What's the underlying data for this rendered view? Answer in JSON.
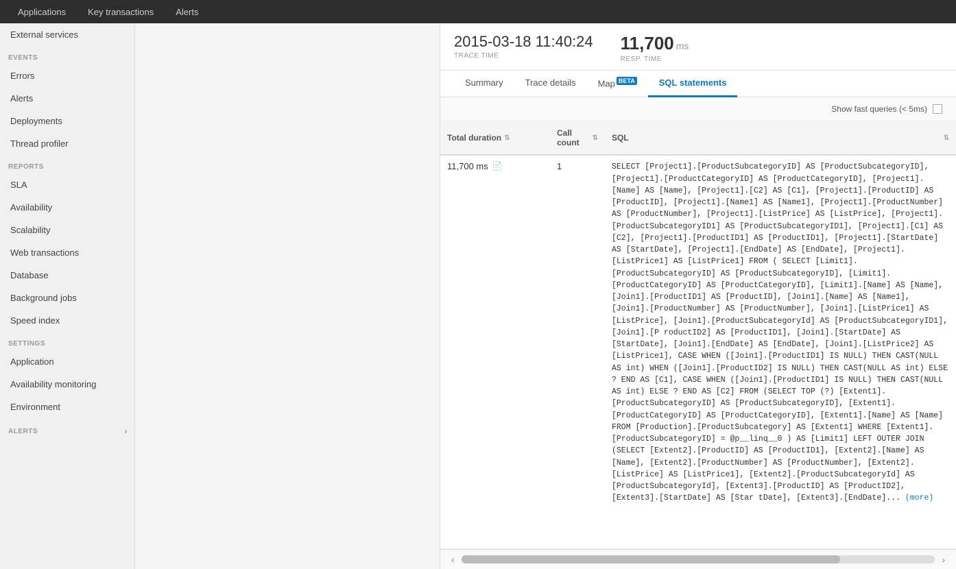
{
  "topnav": {
    "items": [
      {
        "label": "Applications",
        "active": false
      },
      {
        "label": "Key transactions",
        "active": false
      },
      {
        "label": "Alerts",
        "active": false
      }
    ]
  },
  "sidebar": {
    "sections": [
      {
        "label": "EVENTS",
        "items": [
          {
            "label": "Errors",
            "active": false
          },
          {
            "label": "Alerts",
            "active": false
          },
          {
            "label": "Deployments",
            "active": false
          },
          {
            "label": "Thread profiler",
            "active": false
          }
        ]
      },
      {
        "label": "REPORTS",
        "items": [
          {
            "label": "SLA",
            "active": false
          },
          {
            "label": "Availability",
            "active": false
          },
          {
            "label": "Scalability",
            "active": false
          },
          {
            "label": "Web transactions",
            "active": false
          },
          {
            "label": "Database",
            "active": false
          },
          {
            "label": "Background jobs",
            "active": false
          },
          {
            "label": "Speed index",
            "active": false
          }
        ]
      },
      {
        "label": "SETTINGS",
        "items": [
          {
            "label": "Application",
            "active": false
          },
          {
            "label": "Availability monitoring",
            "active": false
          },
          {
            "label": "Environment",
            "active": false
          }
        ]
      },
      {
        "label": "ALERTS",
        "items": []
      }
    ],
    "external_services_label": "External services"
  },
  "trace": {
    "time_value": "2015-03-18 11:40:24",
    "time_label": "TRACE TIME",
    "resp_value": "11,700",
    "resp_unit": "ms",
    "resp_label": "RESP. TIME"
  },
  "tabs": [
    {
      "label": "Summary",
      "active": false,
      "beta": false
    },
    {
      "label": "Trace details",
      "active": false,
      "beta": false
    },
    {
      "label": "Map",
      "active": false,
      "beta": true
    },
    {
      "label": "SQL statements",
      "active": true,
      "beta": false
    }
  ],
  "filter": {
    "show_fast_label": "Show fast queries (< 5ms)"
  },
  "table": {
    "headers": [
      {
        "label": "Total duration",
        "sortable": true
      },
      {
        "label": "Call count",
        "sortable": true
      },
      {
        "label": "SQL",
        "sortable": false
      }
    ],
    "rows": [
      {
        "duration": "11,700 ms",
        "call_count": "1",
        "sql_text": "SELECT [Project1].[ProductSubcategoryID] AS [ProductSubcategoryID], [Project1].[ProductCategoryID] AS [ProductCategoryID], [Project1].[Name] AS [Name], [Project1].[C2] AS [C1], [Project1].[ProductID] AS [ProductID], [Project1].[Name1] AS [Name1], [Project1].[ProductNumber] AS [ProductNumber], [Project1].[ListPrice] AS [ListPrice], [Project1].[ProductSubcategoryID1] AS [ProductSubcategoryID1], [Project1].[C1] AS [C2], [Project1].[ProductID1] AS [ProductID1], [Project1].[StartDate] AS [StartDate], [Project1].[EndDate] AS [EndDate], [Project1].[ListPrice1] AS [ListPrice1] FROM ( SELECT [Limit1].[ProductSubcategoryID] AS [ProductSubcategoryID], [Limit1].[ProductCategoryID] AS [ProductCategoryID], [Limit1].[Name] AS [Name], [Join1].[ProductID1] AS [ProductID], [Join1].[Name] AS [Name1], [Join1].[ProductNumber] AS [ProductNumber], [Join1].[ListPrice1] AS [ListPrice], [Join1].[ProductSubcategoryId] AS [ProductSubcategoryID1], [Join1].[P roductID2] AS [ProductID1], [Join1].[StartDate] AS [StartDate], [Join1].[EndDate] AS [EndDate], [Join1].[ListPrice2] AS [ListPrice1], CASE WHEN ([Join1].[ProductID1] IS NULL) THEN CAST(NULL AS int) WHEN ([Join1].[ProductID2] IS NULL) THEN CAST(NULL AS int) ELSE ? END AS [C1], CASE WHEN ([Join1].[ProductID1] IS NULL) THEN CAST(NULL AS int) ELSE ? END AS [C2] FROM (SELECT TOP (?) [Extent1].[ProductSubcategoryID] AS [ProductSubcategoryID], [Extent1].[ProductCategoryID] AS [ProductCategoryID], [Extent1].[Name] AS [Name] FROM [Production].[ProductSubcategory] AS [Extent1] WHERE [Extent1].[ProductSubcategoryID] = @p__linq__0 ) AS [Limit1] LEFT OUTER JOIN (SELECT [Extent2].[ProductID] AS [ProductID1], [Extent2].[Name] AS [Name], [Extent2].[ProductNumber] AS [ProductNumber], [Extent2].[ListPrice] AS [ListPrice1], [Extent2].[ProductSubcategoryId] AS [ProductSubcategoryId], [Extent3].[ProductID] AS [ProductID2], [Extent3].[StartDate] AS [Star tDate], [Extent3].[EndDate]...",
        "more_label": "(more)"
      }
    ]
  }
}
